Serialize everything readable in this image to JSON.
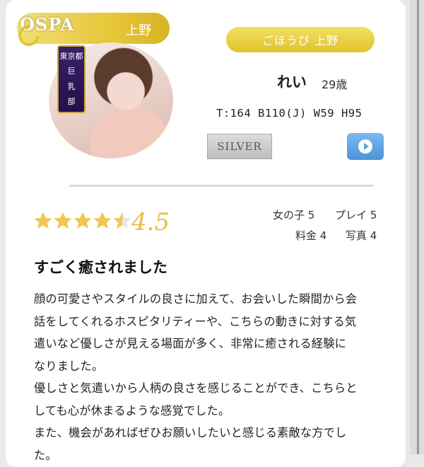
{
  "shop": {
    "logo_text": "OSPA",
    "area": "上野"
  },
  "profile": {
    "badge_lines": [
      "東京都",
      "巨",
      "乳",
      "部"
    ],
    "store_pill": "ごほうび 上野",
    "name": "れい",
    "age": "29歳",
    "measurements": "T:164 B110(J) W59 H95",
    "rank": "SILVER"
  },
  "rating": {
    "value": 4.5,
    "value_label": "4.5",
    "subscores": {
      "girl": "女の子 5",
      "play": "プレイ 5",
      "price": "料金 4",
      "photo": "写真 4"
    }
  },
  "review": {
    "title": "すごく癒されました",
    "lines": [
      "顔の可愛さやスタイルの良さに加えて、お会いした瞬間から会",
      "話をしてくれるホスピタリティーや、こちらの動きに対する気",
      "遣いなど優しさが見える場面が多く、非常に癒される経験に",
      "なりました。",
      "優しさと気遣いから人柄の良さを感じることができ、こちらと",
      "しても心が休まるような感覚でした。",
      "また、機会があればぜひお願いしたいと感じる素敵な方でし",
      "た。"
    ]
  },
  "colors": {
    "gold": "#e6c63a",
    "star": "#efc64f",
    "video": "#5aa2e2",
    "silver": "#c9c9c9"
  },
  "icons": {
    "video": "play-icon",
    "loader": "ring-icon",
    "stars": "star-icon"
  }
}
